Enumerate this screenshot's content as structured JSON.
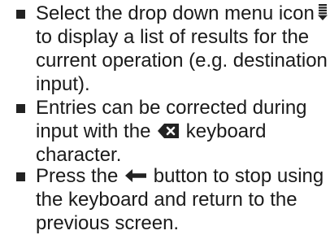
{
  "bullets": [
    {
      "lines": [
        "Select the drop down menu icon",
        "to display a list of results for the",
        "current operation (e.g. destination",
        "input)."
      ],
      "icon": "drop-down-menu-icon"
    },
    {
      "lines_a": "Entries can be corrected during",
      "line_b_pre": "input with the",
      "line_b_post": "keyboard",
      "line_c": "character.",
      "icon": "backspace-key-icon"
    },
    {
      "line_a_pre": "Press the",
      "line_a_post": "button to stop using",
      "line_b": "the keyboard and return to the",
      "line_c": "previous screen.",
      "icon": "back-arrow-icon"
    }
  ]
}
